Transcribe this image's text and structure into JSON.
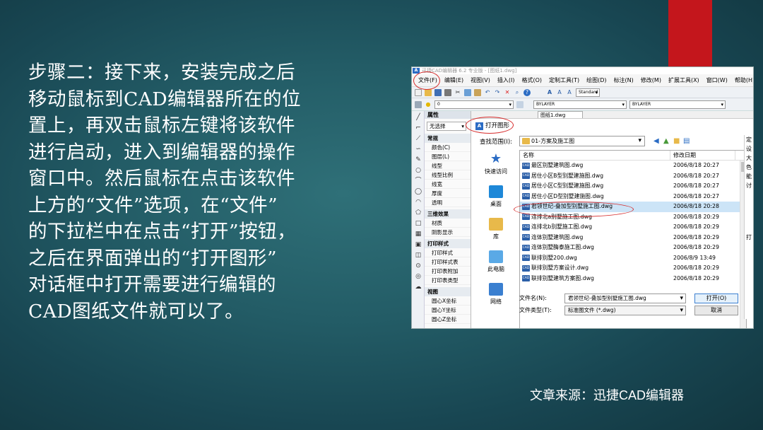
{
  "slide": {
    "paragraph_lines": [
      "步骤二：接下来，安装完成之后",
      "移动鼠标到CAD编辑器所在的位",
      "置上，再双击鼠标左键将该软件",
      "进行启动，进入到编辑器的操作",
      "窗口中。然后鼠标在点击该软件",
      "上方的“文件”选项，在“文件”",
      "的下拉栏中在点击“打开”按钮，",
      "之后在界面弹出的“打开图形”",
      "对话框中打开需要进行编辑的",
      "CAD图纸文件就可以了。"
    ],
    "source": "文章来源：迅捷CAD编辑器"
  },
  "app": {
    "title": "迅捷CAD编辑器 6.2 专业版 - [图纸1.dwg]",
    "logo": "A",
    "menu": [
      "文件(F)",
      "编辑(E)",
      "视图(V)",
      "插入(I)",
      "格式(O)",
      "定制工具(T)",
      "绘图(D)",
      "标注(N)",
      "修改(M)",
      "扩展工具(X)",
      "窗口(W)",
      "帮助(H)"
    ],
    "toolbar": {
      "layer_value": "0",
      "linetype_value": "BYLAYER",
      "lineweight_value": "BYLAYER",
      "style_value": "Standard"
    },
    "properties": {
      "title": "属性",
      "selection": "无选择",
      "sections": [
        {
          "title": "常规",
          "rows": [
            "颜色(C)",
            "图层(L)",
            "线型",
            "线型比例",
            "线宽",
            "厚度",
            "透明"
          ]
        },
        {
          "title": "三维效果",
          "rows": [
            "材质",
            "阴影显示"
          ]
        },
        {
          "title": "打印样式",
          "rows": [
            "打印样式",
            "打印样式表",
            "打印表附加",
            "打印表类型"
          ]
        },
        {
          "title": "视图",
          "rows": [
            "圆心X坐标",
            "圆心Y坐标",
            "圆心Z坐标"
          ]
        }
      ]
    },
    "doc_tab": "图纸1.dwg"
  },
  "dialog": {
    "title": "打开图形",
    "look_in_label": "查找范围(I):",
    "look_in_value": "01-方案及施工图",
    "places": [
      {
        "label": "快速访问",
        "icon": "star-icon"
      },
      {
        "label": "桌面",
        "icon": "desktop-icon"
      },
      {
        "label": "库",
        "icon": "library-icon"
      },
      {
        "label": "此电脑",
        "icon": "computer-icon"
      },
      {
        "label": "网络",
        "icon": "network-icon"
      }
    ],
    "columns": {
      "name": "名称",
      "date": "修改日期"
    },
    "files": [
      {
        "name": "最区别墅建筑图.dwg",
        "date": "2006/8/18 20:27"
      },
      {
        "name": "居住小区B型别墅建施图.dwg",
        "date": "2006/8/18 20:27"
      },
      {
        "name": "居住小区C型别墅建施图.dwg",
        "date": "2006/8/18 20:27"
      },
      {
        "name": "居住小区D型别墅建施图.dwg",
        "date": "2006/8/18 20:27"
      },
      {
        "name": "君领世纪-叠加型别墅施工图.dwg",
        "date": "2006/8/18 20:28"
      },
      {
        "name": "连排北a别墅施工图.dwg",
        "date": "2006/8/18 20:29"
      },
      {
        "name": "连排北b别墅施工图.dwg",
        "date": "2006/8/18 20:29"
      },
      {
        "name": "连体别墅建筑图.dwg",
        "date": "2006/8/18 20:29"
      },
      {
        "name": "连体别墅酶泰施工图.dwg",
        "date": "2006/8/18 20:29"
      },
      {
        "name": "联排别墅200.dwg",
        "date": "2006/8/9 13:49"
      },
      {
        "name": "联排别墅方案设计.dwg",
        "date": "2006/8/18 20:29"
      },
      {
        "name": "联排别墅建筑方案图.dwg",
        "date": "2006/8/18 20:29"
      }
    ],
    "selected_index": 4,
    "filename_label": "文件名(N):",
    "filename_value": "君领世纪-叠加型别墅施工图.dwg",
    "filetype_label": "文件类型(T):",
    "filetype_value": "标准图文件 (*.dwg)",
    "open_button": "打开(O)",
    "cancel_button": "取消",
    "right_panel_chars": [
      "定",
      "设",
      "大",
      "色",
      "能",
      "讨",
      "",
      "",
      "打"
    ]
  },
  "colors": {
    "accent_red": "#c4161c",
    "highlight_circle": "#d62b2b",
    "background": "#235c66",
    "selection": "#cce4f7"
  }
}
